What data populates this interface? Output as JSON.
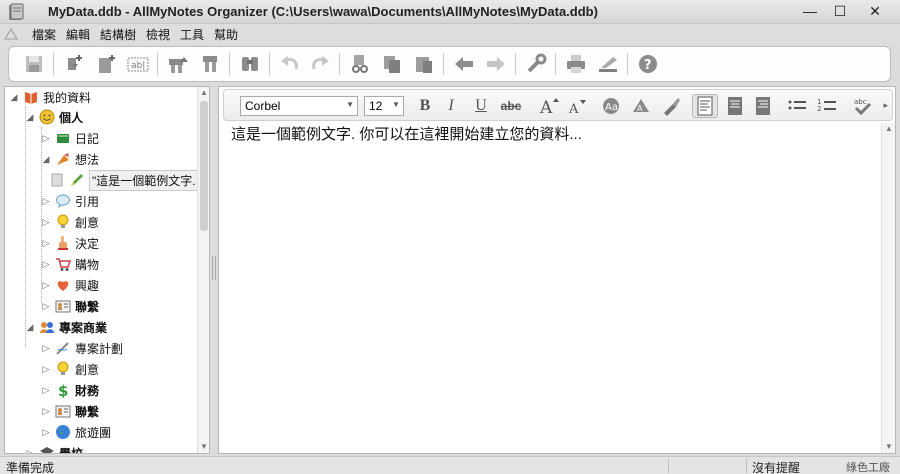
{
  "window": {
    "title": "MyData.ddb - AllMyNotes Organizer (C:\\Users\\wawa\\Documents\\AllMyNotes\\MyData.ddb)",
    "minimize_glyph": "—",
    "maximize_glyph": "☐",
    "close_glyph": "✕"
  },
  "menu": {
    "items": [
      "檔案",
      "編輯",
      "結構樹",
      "檢視",
      "工具",
      "幫助"
    ]
  },
  "toolbar": {
    "icons": [
      "save-icon",
      "new-child-note-icon",
      "new-note-icon",
      "rename-icon",
      "move-up-icon",
      "move-down-icon",
      "find-icon",
      "undo-icon",
      "redo-icon",
      "cut-icon",
      "copy-icon",
      "paste-icon",
      "back-icon",
      "forward-icon",
      "settings-icon",
      "print-icon",
      "scanner-icon",
      "help-icon"
    ]
  },
  "tree": {
    "root": "我的資料",
    "items": [
      {
        "label": "個人",
        "bold": true
      },
      {
        "label": "日記"
      },
      {
        "label": "想法"
      },
      {
        "label": "\"這是一個範例文字."
      },
      {
        "label": "引用"
      },
      {
        "label": "創意"
      },
      {
        "label": "決定"
      },
      {
        "label": "購物"
      },
      {
        "label": "興趣"
      },
      {
        "label": "聯繫",
        "bold": true
      },
      {
        "label": "專案商業",
        "bold": true
      },
      {
        "label": "專案計劃"
      },
      {
        "label": "創意"
      },
      {
        "label": "財務",
        "bold": true
      },
      {
        "label": "聯繫",
        "bold": true
      },
      {
        "label": "旅遊團"
      },
      {
        "label": "學校",
        "bold": true
      }
    ]
  },
  "format": {
    "font": "Corbel",
    "size": "12",
    "bold_glyph": "B",
    "italic_glyph": "I",
    "underline_glyph": "U",
    "strike_glyph": "abc"
  },
  "editor": {
    "text": "這是一個範例文字. 你可以在這裡開始建立您的資料..."
  },
  "status": {
    "left": "準備完成",
    "right": "沒有提醒",
    "watermark": "綠色工廠"
  }
}
